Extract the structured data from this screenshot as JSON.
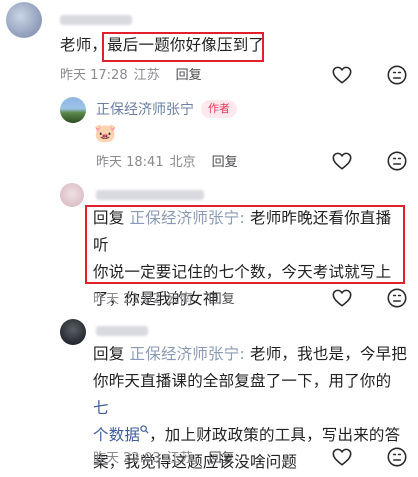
{
  "comment1": {
    "text_prefix": "老师，",
    "text_highlight": "最后一题你好像压到了",
    "time": "昨天 17:28",
    "location": "江苏",
    "reply_label": "回复"
  },
  "reply1": {
    "username": "正保经济师张宁",
    "badge": "作者",
    "emoji": "🐷",
    "time": "昨天 18:41",
    "location": "北京",
    "reply_label": "回复"
  },
  "comment2": {
    "reply_prefix": "回复",
    "mention": "正保经济师张宁:",
    "line1_rest": "老师昨晚还看你直播听",
    "line2": "你说一定要记住的七个数，今天考试就写上",
    "line3": "了，你是我的女神",
    "time": "昨天 21:02",
    "location": "云南",
    "reply_label": "回复"
  },
  "comment3": {
    "reply_prefix": "回复",
    "mention": "正保经济师张宁:",
    "line1_rest": "老师，我也是，今早把",
    "line2_a": "你昨天直播课的全部复盘了一下，用了你的",
    "line2_link": "七",
    "line3_link": "个数据",
    "line3_rest": "，加上财政政策的工具，写出来的答",
    "line4": "案，我觉得这题应该没啥问题",
    "time": "昨天 22:03",
    "location": "江苏",
    "reply_label": "回复"
  },
  "colors": {
    "highlight_box": "#e0202a",
    "author_badge": "#e6395b",
    "link": "#3f5f9e"
  }
}
